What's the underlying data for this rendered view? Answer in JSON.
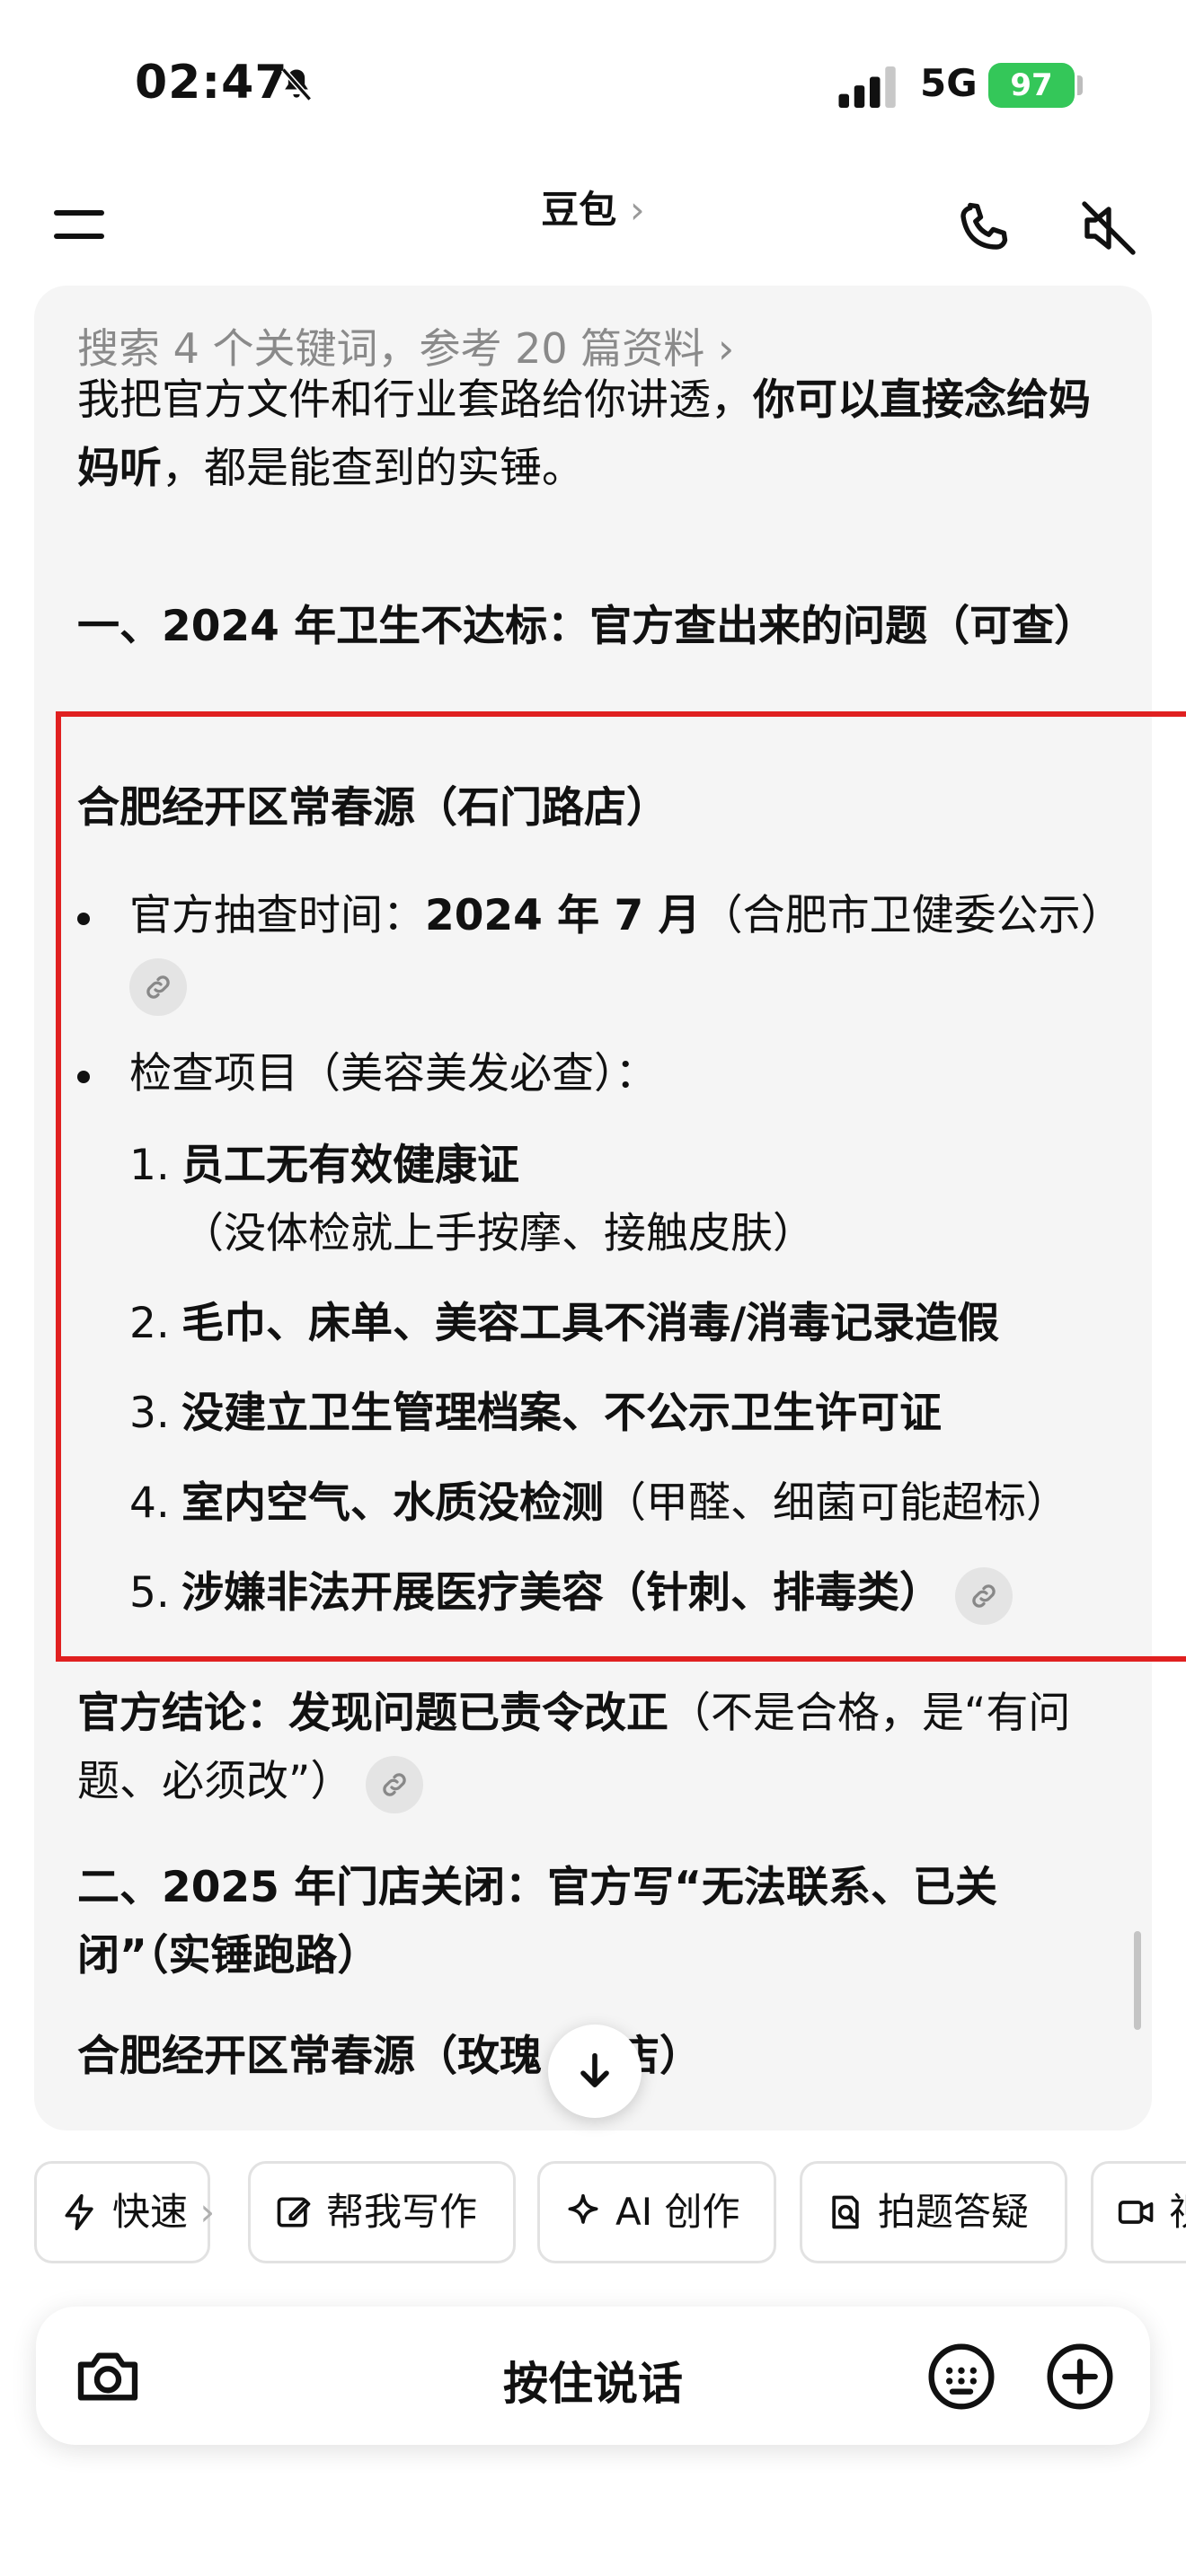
{
  "status_bar": {
    "time": "02:47",
    "network": "5G",
    "battery": "97"
  },
  "nav": {
    "title": "豆包",
    "title_chevron": "›"
  },
  "chat": {
    "search_summary": "搜索 4 个关键词，参考 20 篇资料 ›",
    "intro_normal_1": "我把官方文件和行业套路给你讲透，",
    "intro_bold": "你可以直接念给妈妈听",
    "intro_normal_2": "，都是能查到的实锤。",
    "section1_heading": "一、2024 年卫生不达标：官方查出来的问题（可查）",
    "store1_name": "合肥经开区常春源（石门路店）",
    "bullet1_label": "官方抽查时间：",
    "bullet1_bold": "2024 年 7 月",
    "bullet1_note": "（合肥市卫健委公示）",
    "bullet2_text": "检查项目（美容美发必查）：",
    "items": [
      {
        "num": "1.",
        "bold": "员工无有效健康证",
        "normal": "（没体检就上手按摩、接触皮肤）"
      },
      {
        "num": "2.",
        "bold": "毛巾、床单、美容工具不消毒/消毒记录造假",
        "normal": ""
      },
      {
        "num": "3.",
        "bold": "没建立卫生管理档案、不公示卫生许可证",
        "normal": ""
      },
      {
        "num": "4.",
        "bold": "室内空气、水质没检测",
        "normal": "（甲醛、细菌可能超标）"
      },
      {
        "num": "5.",
        "bold": "涉嫌非法开展医疗美容（针刺、排毒类）",
        "normal": ""
      }
    ],
    "conclusion_bold": "官方结论：发现问题已责令改正",
    "conclusion_normal": "（不是合格，是“有问题、必须改”）",
    "section2_heading": "二、2025 年门店关闭：官方写“无法联系、已关闭”（实锤跑路）",
    "store2_name_partial": "合肥经开区常春源（玫瑰",
    "store2_name_tail": "店）"
  },
  "quick_actions": [
    {
      "label": "快速",
      "chevron": "›",
      "icon": "lightning-icon"
    },
    {
      "label": "帮我写作",
      "icon": "edit-icon"
    },
    {
      "label": "AI 创作",
      "icon": "sparkle-icon"
    },
    {
      "label": "拍题答疑",
      "icon": "scan-question-icon"
    },
    {
      "label": "视",
      "icon": "video-icon"
    }
  ],
  "input_bar": {
    "hold_to_talk": "按住说话"
  },
  "colors": {
    "highlight": "#e02020",
    "battery": "#34c759",
    "card": "#f5f5f5"
  }
}
